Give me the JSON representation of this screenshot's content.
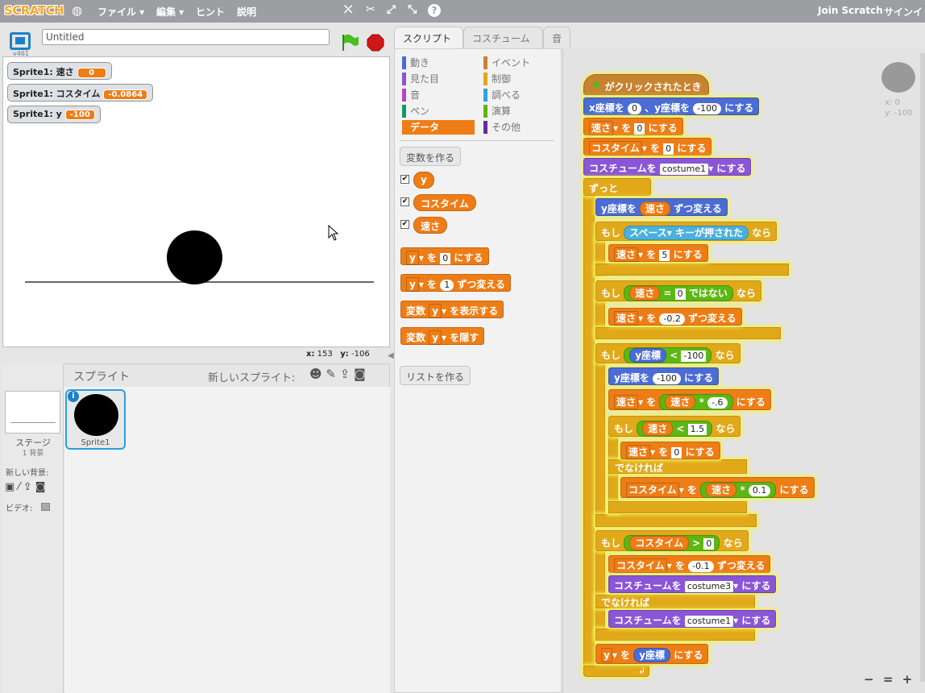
{
  "menu": {
    "logo": "SCRATCH",
    "file": "ファイル ▾",
    "edit": "編集 ▾",
    "hints": "ヒント",
    "about": "説明",
    "join": "Join Scratch",
    "signin": "サインイ"
  },
  "stage": {
    "version": "v461",
    "title_value": "Untitled",
    "monitors": [
      {
        "label": "Sprite1: 速さ",
        "value": "0"
      },
      {
        "label": "Sprite1: コスタイム",
        "value": "-0.0864"
      },
      {
        "label": "Sprite1: y",
        "value": "-100"
      }
    ],
    "coords": {
      "x_label": "x:",
      "x": "153",
      "y_label": "y:",
      "y": "-106"
    }
  },
  "sprites": {
    "header": "スプライト",
    "new_sprite": "新しいスプライト:",
    "stage_label": "ステージ",
    "stage_sub": "1 背景",
    "new_backdrop": "新しい背景:",
    "video": "ビデオ:",
    "sprite1": "Sprite1"
  },
  "tabs": [
    "スクリプト",
    "コスチューム",
    "音"
  ],
  "categories": {
    "left": [
      "動き",
      "見た目",
      "音",
      "ペン",
      "データ"
    ],
    "right": [
      "イベント",
      "制御",
      "調べる",
      "演算",
      "その他"
    ],
    "colors_left": [
      "#4a6cd4",
      "#8a55d7",
      "#bb42c3",
      "#0e9a6c",
      "#ee7d16"
    ],
    "colors_right": [
      "#c88330",
      "#e1a91a",
      "#2ca5e2",
      "#5cb712",
      "#632d99"
    ]
  },
  "palette": {
    "make_var": "変数を作る",
    "vars": [
      "y",
      "コスタイム",
      "速さ"
    ],
    "set_block": {
      "var": "y",
      "to": "を",
      "val": "0",
      "suffix": "にする"
    },
    "change_block": {
      "var": "y",
      "to": "を",
      "val": "1",
      "suffix": "ずつ変える"
    },
    "show_block": {
      "pre": "変数",
      "var": "y",
      "suffix": "を表示する"
    },
    "hide_block": {
      "pre": "変数",
      "var": "y",
      "suffix": "を隠す"
    },
    "make_list": "リストを作る"
  },
  "script": {
    "hat": "がクリックされたとき",
    "goto": {
      "a": "x座標を",
      "x": "0",
      "b": "、y座標を",
      "y": "-100",
      "c": "にする"
    },
    "set_speed": {
      "var": "速さ",
      "a": "を",
      "v": "0",
      "b": "にする"
    },
    "set_costime": {
      "var": "コスタイム",
      "a": "を",
      "v": "0",
      "b": "にする"
    },
    "switch1": {
      "a": "コスチュームを",
      "v": "costume1",
      "b": "にする"
    },
    "forever": "ずっと",
    "change_y": {
      "a": "y座標を",
      "v": "速さ",
      "b": "ずつ変える"
    },
    "if1": {
      "kw": "もし",
      "key": "スペース",
      "cond": "キーが押された",
      "then": "なら"
    },
    "set_speed5": {
      "var": "速さ",
      "a": "を",
      "v": "5",
      "b": "にする"
    },
    "if2": {
      "kw": "もし",
      "lhs": "速さ",
      "op": "=",
      "rhs": "0",
      "not": "ではない",
      "then": "なら"
    },
    "change_speed": {
      "var": "速さ",
      "a": "を",
      "v": "-0.2",
      "b": "ずつ変える"
    },
    "if3": {
      "kw": "もし",
      "lhs": "y座標",
      "op": "<",
      "rhs": "-100",
      "then": "なら"
    },
    "set_y": {
      "a": "y座標を",
      "v": "-100",
      "b": "にする"
    },
    "set_speed_mul": {
      "var": "速さ",
      "a": "を",
      "lhs": "速さ",
      "op": "*",
      "rhs": "-.6",
      "b": "にする"
    },
    "if4": {
      "kw": "もし",
      "lhs": "速さ",
      "op": "<",
      "rhs": "1.5",
      "then": "なら"
    },
    "set_speed0": {
      "var": "速さ",
      "a": "を",
      "v": "0",
      "b": "にする"
    },
    "else1": "でなければ",
    "set_costime_mul": {
      "var": "コスタイム",
      "a": "を",
      "lhs": "速さ",
      "op": "*",
      "rhs": "0.1",
      "b": "にする"
    },
    "if5": {
      "kw": "もし",
      "lhs": "コスタイム",
      "op": ">",
      "rhs": "0",
      "then": "なら"
    },
    "change_costime": {
      "var": "コスタイム",
      "a": "を",
      "v": "-0.1",
      "b": "ずつ変える"
    },
    "switch3": {
      "a": "コスチュームを",
      "v": "costume3",
      "b": "にする"
    },
    "else2": "でなければ",
    "switch1b": {
      "a": "コスチュームを",
      "v": "costume1",
      "b": "にする"
    },
    "set_yvar": {
      "var": "y",
      "a": "を",
      "v": "y座標",
      "b": "にする"
    }
  },
  "sprite_info": {
    "x_label": "x: 0",
    "y_label": "y: -100"
  },
  "zoom": {
    "out": "−",
    "reset": "=",
    "in": "+"
  }
}
